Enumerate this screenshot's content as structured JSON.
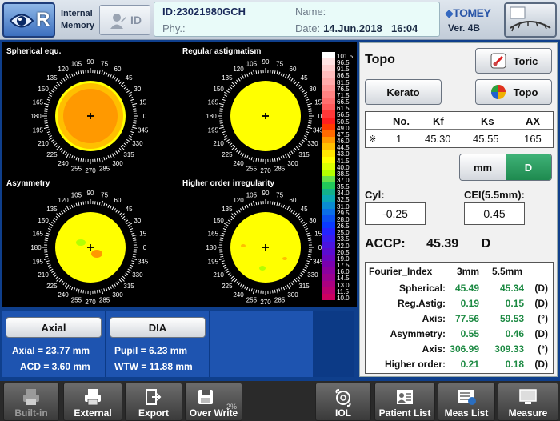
{
  "header": {
    "eye_letter": "R",
    "memory_line1": "Internal",
    "memory_line2": "Memory",
    "id_button": "ID",
    "patient_id_label": "ID:",
    "patient_id": "23021980GCH",
    "name_label": "Name:",
    "name_value": "",
    "phy_label": "Phy.:",
    "date_label": "Date:",
    "date_value": "14.Jun.2018",
    "time_value": "16:04",
    "brand": "TOMEY",
    "version": "Ver. 4B"
  },
  "maps": {
    "titles": [
      "Spherical equ.",
      "Regular astigmatism",
      "Asymmetry",
      "Higher order irregularity"
    ],
    "angle_labels": [
      "105",
      "90",
      "75",
      "120",
      "60",
      "135",
      "45",
      "150",
      "30",
      "165",
      "15",
      "180",
      "0",
      "195",
      "345",
      "210",
      "330",
      "225",
      "315",
      "240",
      "300",
      "255",
      "270",
      "285"
    ],
    "scale_labels": [
      "101.5",
      "96.5",
      "91.5",
      "86.5",
      "81.5",
      "76.5",
      "71.5",
      "66.5",
      "61.5",
      "56.5",
      "50.5",
      "49.0",
      "47.5",
      "46.0",
      "44.5",
      "43.0",
      "41.5",
      "40.0",
      "38.5",
      "37.0",
      "35.5",
      "34.0",
      "32.5",
      "31.0",
      "29.5",
      "28.0",
      "26.5",
      "25.0",
      "23.5",
      "22.0",
      "20.5",
      "19.0",
      "17.5",
      "16.0",
      "14.5",
      "13.0",
      "11.5",
      "10.0"
    ],
    "scale_colors": [
      "#ffffff",
      "#ffe3e3",
      "#ffd0d0",
      "#ffbdbd",
      "#ffaaaa",
      "#ff9696",
      "#ff8282",
      "#ff6e6e",
      "#ff5a5a",
      "#ff3838",
      "#ff1f1f",
      "#ff3a00",
      "#ff6a00",
      "#ff9900",
      "#ffbf00",
      "#ffe600",
      "#ffff00",
      "#dcff00",
      "#b4ff00",
      "#66e04a",
      "#22c85a",
      "#12b08a",
      "#0aa8b4",
      "#0a8cd2",
      "#0a6ee6",
      "#0a50f0",
      "#0a3aff",
      "#2424ff",
      "#3a1cf0",
      "#4a14e0",
      "#5a0cd0",
      "#6a06c0",
      "#7a00b0",
      "#8a00a0",
      "#9a0090",
      "#aa0080",
      "#ba0070",
      "#cc0060"
    ]
  },
  "topo": {
    "title": "Topo",
    "toric_button": "Toric",
    "kerato_button": "Kerato",
    "topo_button": "Topo",
    "table_headers": [
      "No.",
      "Kf",
      "Ks",
      "AX"
    ],
    "table_row": {
      "mark": "※",
      "no": "1",
      "kf": "45.30",
      "ks": "45.55",
      "ax": "165"
    },
    "unit_mm": "mm",
    "unit_d": "D",
    "cyl_label": "Cyl:",
    "cyl_value": "-0.25",
    "cei_label": "CEI(5.5mm):",
    "cei_value": "0.45",
    "accp_label": "ACCP:",
    "accp_value": "45.39",
    "accp_unit": "D"
  },
  "fourier": {
    "header": {
      "name": "Fourier_Index",
      "c1": "3mm",
      "c2": "5.5mm"
    },
    "rows": [
      {
        "name": "Spherical:",
        "v1": "45.49",
        "v2": "45.34",
        "unit": "(D)"
      },
      {
        "name": "Reg.Astig:",
        "v1": "0.19",
        "v2": "0.15",
        "unit": "(D)"
      },
      {
        "name": "Axis:",
        "v1": "77.56",
        "v2": "59.53",
        "unit": "(°)"
      },
      {
        "name": "Asymmetry:",
        "v1": "0.55",
        "v2": "0.46",
        "unit": "(D)"
      },
      {
        "name": "Axis:",
        "v1": "306.99",
        "v2": "309.33",
        "unit": "(°)"
      },
      {
        "name": "Higher order:",
        "v1": "0.21",
        "v2": "0.18",
        "unit": "(D)"
      }
    ]
  },
  "info": {
    "axial_button": "Axial",
    "axial_value": "Axial = 23.77 mm",
    "acd_value": "ACD = 3.60 mm",
    "dia_button": "DIA",
    "pupil_value": "Pupil = 6.23 mm",
    "wtw_value": "WTW = 11.88 mm"
  },
  "toolbar": {
    "builtin": "Built-in",
    "external": "External",
    "export": "Export",
    "overwrite": "Over Write",
    "overwrite_pct": "2%",
    "iol": "IOL",
    "patient_list": "Patient List",
    "meas_list": "Meas List",
    "measure": "Measure"
  }
}
